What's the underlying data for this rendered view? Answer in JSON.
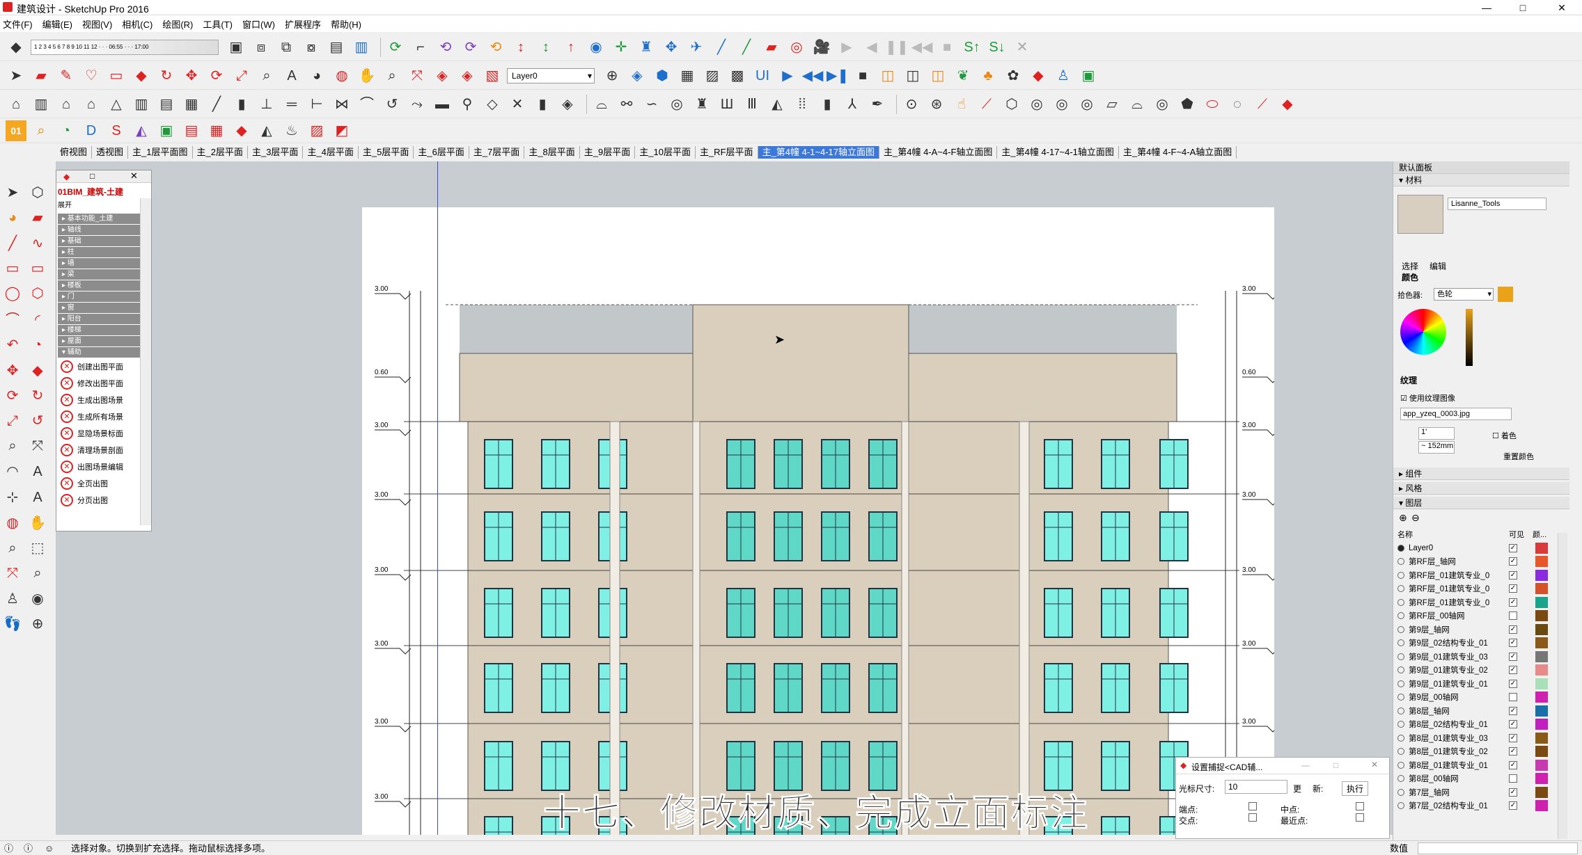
{
  "window": {
    "title": "建筑设计 - SketchUp Pro 2016",
    "min": "—",
    "max": "□",
    "close": "✕"
  },
  "menu": [
    "文件(F)",
    "编辑(E)",
    "视图(V)",
    "相机(C)",
    "绘图(R)",
    "工具(T)",
    "窗口(W)",
    "扩展程序",
    "帮助(H)"
  ],
  "toolbar": {
    "layer_select": "Layer0"
  },
  "scene_tabs": [
    "俯视图",
    "透视图",
    "主_1层平面图",
    "主_2层平面",
    "主_3层平面",
    "主_4层平面",
    "主_5层平面",
    "主_6层平面",
    "主_7层平面",
    "主_8层平面",
    "主_9层平面",
    "主_10层平面",
    "主_RF层平面",
    "主_第4幢 4-1~4-17轴立面图",
    "主_第4幢 4-A~4-F轴立面图",
    "主_第4幢 4-17~4-1轴立面图",
    "主_第4幢 4-F~4-A轴立面图"
  ],
  "active_scene": 13,
  "plugin": {
    "title": "01BIM_建筑-土建",
    "expand_label": "展开",
    "groups": [
      "基本功能_土建",
      "轴线",
      "基础",
      "柱",
      "墙",
      "梁",
      "楼板",
      "门",
      "窗",
      "阳台",
      "楼梯",
      "屋面",
      "辅助"
    ],
    "commands": [
      "创建出图平面",
      "修改出图平面",
      "生成出图场景",
      "生成所有场景",
      "显隐场景标面",
      "清理场景剖面",
      "出图场景编辑",
      "全页出图",
      "分页出图"
    ]
  },
  "right_panel": {
    "title": "默认面板",
    "materials_header": "材料",
    "material_name": "Lisanne_Tools",
    "tab_select": "选择",
    "tab_edit": "编辑",
    "color_label": "颜色",
    "picker_label": "拾色器:",
    "picker_value": "色轮",
    "texture_label": "纹理",
    "use_texture_label": "使用纹理图像",
    "texture_file": "app_yzeq_0003.jpg",
    "tex_w": "1'",
    "tex_h": "~ 152mm",
    "colorize_label": "着色",
    "reset_color_label": "重置颜色",
    "components_label": "组件",
    "styles_label": "风格",
    "layers_label": "图层",
    "col_name": "名称",
    "col_visible": "可见",
    "col_color": "颜...",
    "accent_color": "#e9a21a"
  },
  "layers": [
    {
      "name": "Layer0",
      "active": true,
      "visible": true,
      "color": "#d93a3a"
    },
    {
      "name": "第RF层_轴网",
      "active": false,
      "visible": true,
      "color": "#e8562a"
    },
    {
      "name": "第RF层_01建筑专业_0",
      "active": false,
      "visible": true,
      "color": "#8a2be2"
    },
    {
      "name": "第RF层_01建筑专业_0",
      "active": false,
      "visible": true,
      "color": "#d4522a"
    },
    {
      "name": "第RF层_01建筑专业_0",
      "active": false,
      "visible": true,
      "color": "#1ca38c"
    },
    {
      "name": "第RF层_00轴网",
      "active": false,
      "visible": false,
      "color": "#7a4a12"
    },
    {
      "name": "第9层_轴网",
      "active": false,
      "visible": true,
      "color": "#6b4a10"
    },
    {
      "name": "第9层_02结构专业_01",
      "active": false,
      "visible": true,
      "color": "#8a5a18"
    },
    {
      "name": "第9层_01建筑专业_03",
      "active": false,
      "visible": true,
      "color": "#777777"
    },
    {
      "name": "第9层_01建筑专业_02",
      "active": false,
      "visible": true,
      "color": "#e88a8a"
    },
    {
      "name": "第9层_01建筑专业_01",
      "active": false,
      "visible": true,
      "color": "#a8e0b8"
    },
    {
      "name": "第9层_00轴网",
      "active": false,
      "visible": false,
      "color": "#d020b0"
    },
    {
      "name": "第8层_轴网",
      "active": false,
      "visible": true,
      "color": "#1a6fa8"
    },
    {
      "name": "第8层_02结构专业_01",
      "active": false,
      "visible": true,
      "color": "#c020c0"
    },
    {
      "name": "第8层_01建筑专业_03",
      "active": false,
      "visible": true,
      "color": "#8a5a18"
    },
    {
      "name": "第8层_01建筑专业_02",
      "active": false,
      "visible": true,
      "color": "#7a4a12"
    },
    {
      "name": "第8层_01建筑专业_01",
      "active": false,
      "visible": true,
      "color": "#c83ab0"
    },
    {
      "name": "第8层_00轴网",
      "active": false,
      "visible": false,
      "color": "#d020b0"
    },
    {
      "name": "第7层_轴网",
      "active": false,
      "visible": true,
      "color": "#7a4a12"
    },
    {
      "name": "第7层_02结构专业_01",
      "active": false,
      "visible": true,
      "color": "#d020b0"
    }
  ],
  "cad_window": {
    "title": "设置捕捉<CAD辅...",
    "cursor_label": "光标尺寸:",
    "cursor_value": "10",
    "btn_update": "更",
    "btn_new": "新:",
    "btn_exec": "执行",
    "row1_a": "端点:",
    "row1_b": "中点:",
    "row2_a": "交点:",
    "row2_b": "最近点:"
  },
  "subtitle": "十七、修改材质、完成立面标注",
  "status": {
    "text": "选择对象。切换到扩充选择。拖动鼠标选择多项。",
    "measure_label": "数值"
  },
  "elevation_labels": {
    "left_top": "3.00",
    "levels": [
      "3.00",
      "0.60",
      "3.00",
      "3.00",
      "3.00",
      "3.00",
      "3.00"
    ]
  }
}
